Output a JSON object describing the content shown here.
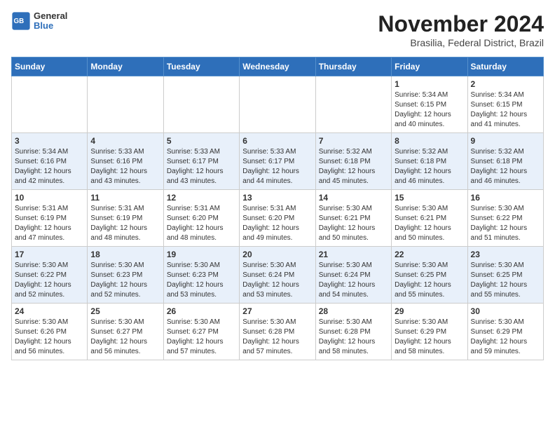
{
  "header": {
    "logo_general": "General",
    "logo_blue": "Blue",
    "month_title": "November 2024",
    "location": "Brasilia, Federal District, Brazil"
  },
  "days_of_week": [
    "Sunday",
    "Monday",
    "Tuesday",
    "Wednesday",
    "Thursday",
    "Friday",
    "Saturday"
  ],
  "weeks": [
    [
      {
        "day": "",
        "info": ""
      },
      {
        "day": "",
        "info": ""
      },
      {
        "day": "",
        "info": ""
      },
      {
        "day": "",
        "info": ""
      },
      {
        "day": "",
        "info": ""
      },
      {
        "day": "1",
        "info": "Sunrise: 5:34 AM\nSunset: 6:15 PM\nDaylight: 12 hours and 40 minutes."
      },
      {
        "day": "2",
        "info": "Sunrise: 5:34 AM\nSunset: 6:15 PM\nDaylight: 12 hours and 41 minutes."
      }
    ],
    [
      {
        "day": "3",
        "info": "Sunrise: 5:34 AM\nSunset: 6:16 PM\nDaylight: 12 hours and 42 minutes."
      },
      {
        "day": "4",
        "info": "Sunrise: 5:33 AM\nSunset: 6:16 PM\nDaylight: 12 hours and 43 minutes."
      },
      {
        "day": "5",
        "info": "Sunrise: 5:33 AM\nSunset: 6:17 PM\nDaylight: 12 hours and 43 minutes."
      },
      {
        "day": "6",
        "info": "Sunrise: 5:33 AM\nSunset: 6:17 PM\nDaylight: 12 hours and 44 minutes."
      },
      {
        "day": "7",
        "info": "Sunrise: 5:32 AM\nSunset: 6:18 PM\nDaylight: 12 hours and 45 minutes."
      },
      {
        "day": "8",
        "info": "Sunrise: 5:32 AM\nSunset: 6:18 PM\nDaylight: 12 hours and 46 minutes."
      },
      {
        "day": "9",
        "info": "Sunrise: 5:32 AM\nSunset: 6:18 PM\nDaylight: 12 hours and 46 minutes."
      }
    ],
    [
      {
        "day": "10",
        "info": "Sunrise: 5:31 AM\nSunset: 6:19 PM\nDaylight: 12 hours and 47 minutes."
      },
      {
        "day": "11",
        "info": "Sunrise: 5:31 AM\nSunset: 6:19 PM\nDaylight: 12 hours and 48 minutes."
      },
      {
        "day": "12",
        "info": "Sunrise: 5:31 AM\nSunset: 6:20 PM\nDaylight: 12 hours and 48 minutes."
      },
      {
        "day": "13",
        "info": "Sunrise: 5:31 AM\nSunset: 6:20 PM\nDaylight: 12 hours and 49 minutes."
      },
      {
        "day": "14",
        "info": "Sunrise: 5:30 AM\nSunset: 6:21 PM\nDaylight: 12 hours and 50 minutes."
      },
      {
        "day": "15",
        "info": "Sunrise: 5:30 AM\nSunset: 6:21 PM\nDaylight: 12 hours and 50 minutes."
      },
      {
        "day": "16",
        "info": "Sunrise: 5:30 AM\nSunset: 6:22 PM\nDaylight: 12 hours and 51 minutes."
      }
    ],
    [
      {
        "day": "17",
        "info": "Sunrise: 5:30 AM\nSunset: 6:22 PM\nDaylight: 12 hours and 52 minutes."
      },
      {
        "day": "18",
        "info": "Sunrise: 5:30 AM\nSunset: 6:23 PM\nDaylight: 12 hours and 52 minutes."
      },
      {
        "day": "19",
        "info": "Sunrise: 5:30 AM\nSunset: 6:23 PM\nDaylight: 12 hours and 53 minutes."
      },
      {
        "day": "20",
        "info": "Sunrise: 5:30 AM\nSunset: 6:24 PM\nDaylight: 12 hours and 53 minutes."
      },
      {
        "day": "21",
        "info": "Sunrise: 5:30 AM\nSunset: 6:24 PM\nDaylight: 12 hours and 54 minutes."
      },
      {
        "day": "22",
        "info": "Sunrise: 5:30 AM\nSunset: 6:25 PM\nDaylight: 12 hours and 55 minutes."
      },
      {
        "day": "23",
        "info": "Sunrise: 5:30 AM\nSunset: 6:25 PM\nDaylight: 12 hours and 55 minutes."
      }
    ],
    [
      {
        "day": "24",
        "info": "Sunrise: 5:30 AM\nSunset: 6:26 PM\nDaylight: 12 hours and 56 minutes."
      },
      {
        "day": "25",
        "info": "Sunrise: 5:30 AM\nSunset: 6:27 PM\nDaylight: 12 hours and 56 minutes."
      },
      {
        "day": "26",
        "info": "Sunrise: 5:30 AM\nSunset: 6:27 PM\nDaylight: 12 hours and 57 minutes."
      },
      {
        "day": "27",
        "info": "Sunrise: 5:30 AM\nSunset: 6:28 PM\nDaylight: 12 hours and 57 minutes."
      },
      {
        "day": "28",
        "info": "Sunrise: 5:30 AM\nSunset: 6:28 PM\nDaylight: 12 hours and 58 minutes."
      },
      {
        "day": "29",
        "info": "Sunrise: 5:30 AM\nSunset: 6:29 PM\nDaylight: 12 hours and 58 minutes."
      },
      {
        "day": "30",
        "info": "Sunrise: 5:30 AM\nSunset: 6:29 PM\nDaylight: 12 hours and 59 minutes."
      }
    ]
  ]
}
